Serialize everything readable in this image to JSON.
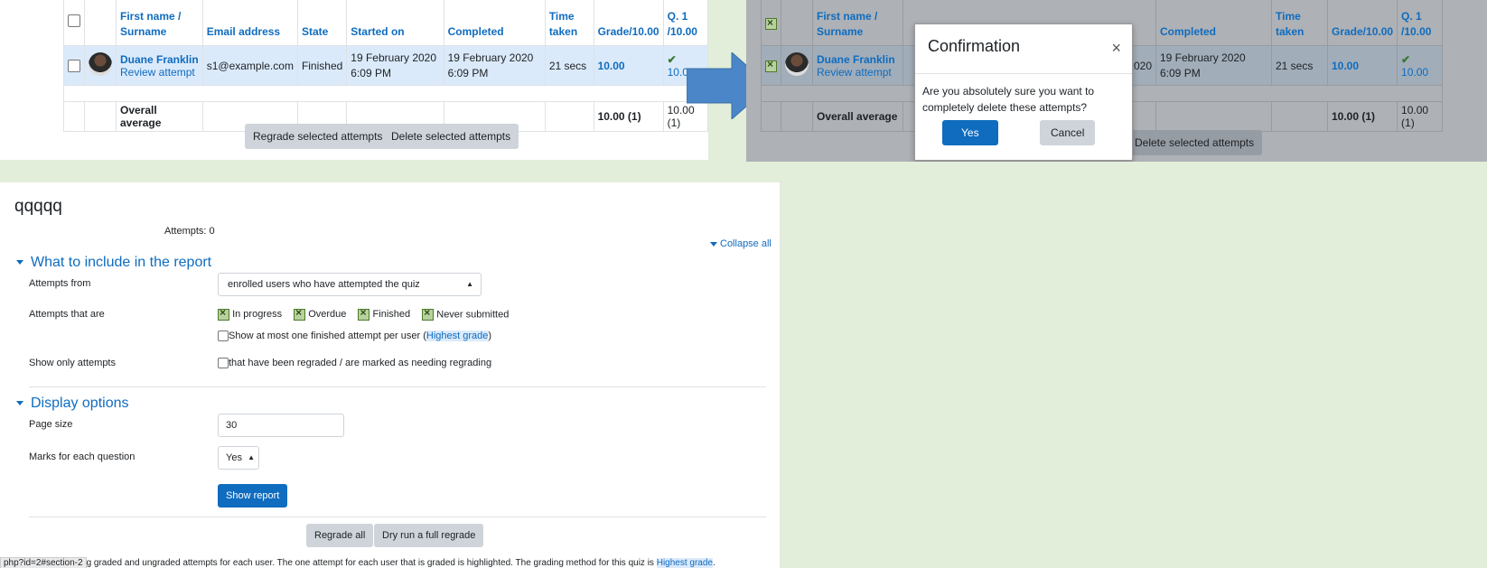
{
  "table": {
    "headers": {
      "first_name": "First name",
      "surname": "Surname",
      "email": "Email address",
      "state": "State",
      "started": "Started on",
      "completed": "Completed",
      "time_taken_1": "Time",
      "time_taken_2": "taken",
      "grade": "Grade/10.00",
      "q1_a": "Q. 1",
      "q1_b": "/10.00"
    },
    "row": {
      "name": "Duane Franklin",
      "review": "Review attempt",
      "email": "s1@example.com",
      "state": "Finished",
      "started": "19 February 2020 6:09 PM",
      "completed": "19 February 2020 6:09 PM",
      "time_taken": "21 secs",
      "grade": "10.00",
      "q1": "10.00"
    },
    "average": {
      "label": "Overall average",
      "grade": "10.00 (1)",
      "q1": "10.00 (1)"
    },
    "buttons": {
      "regrade_selected": "Regrade selected attempts",
      "delete_selected": "Delete selected attempts"
    }
  },
  "modal": {
    "title": "Confirmation",
    "close": "×",
    "message": "Are you absolutely sure you want to completely delete these attempts?",
    "yes": "Yes",
    "cancel": "Cancel",
    "started_partial": "2020"
  },
  "form": {
    "quiz_name": "qqqqq",
    "attempts_count": "Attempts: 0",
    "collapse_all": "Collapse all",
    "section_include": "What to include in the report",
    "attempts_from_label": "Attempts from",
    "attempts_from_value": "enrolled users who have attempted the quiz",
    "attempts_that_are_label": "Attempts that are",
    "states": [
      "In progress",
      "Overdue",
      "Finished",
      "Never submitted"
    ],
    "one_attempt_text": "Show at most one finished attempt per user (",
    "one_attempt_link": "Highest grade",
    "one_attempt_close": ")",
    "show_only_label": "Show only attempts",
    "regraded_text": "that have been regraded / are marked as needing regrading",
    "section_display": "Display options",
    "page_size_label": "Page size",
    "page_size_value": "30",
    "marks_label": "Marks for each question",
    "marks_value": "Yes",
    "show_report": "Show report",
    "regrade_all": "Regrade all",
    "dry_run": "Dry run a full regrade",
    "footer_status": "php?id=2#section-2",
    "footer_text": "g graded and ungraded attempts for each user. The one attempt for each user that is graded is highlighted. The grading method for this quiz is ",
    "footer_link": "Highest grade",
    "footer_end": "."
  },
  "colors": {
    "link": "#0f6cbf",
    "primary": "#0f6cbf",
    "background": "#e2eed9",
    "arrow": "#4a86c8"
  }
}
